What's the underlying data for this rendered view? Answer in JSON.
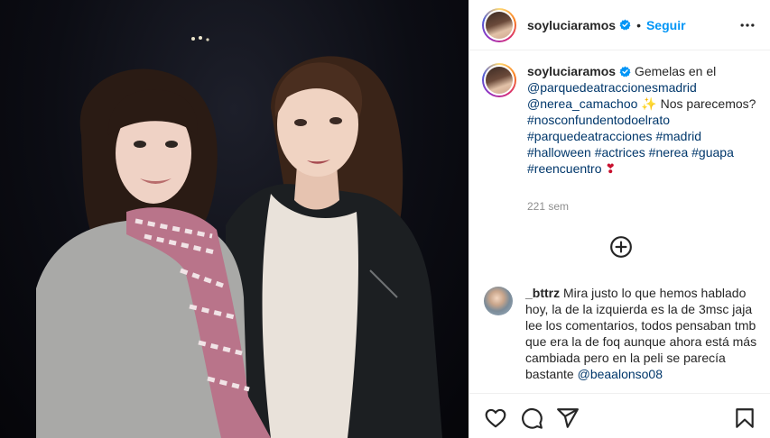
{
  "post": {
    "author": "soyluciaramos",
    "separator": "•",
    "follow_label": "Seguir",
    "more_icon": "more-horizontal-icon",
    "verified_color": "#0095f6"
  },
  "caption": {
    "username": "soyluciaramos",
    "intro": "Gemelas en el",
    "mention_1": "@parquedeatraccionesmadrid",
    "mention_2": "@nerea_camachoo",
    "sparkle_emoji": "✨",
    "question": "Nos parecemos?",
    "hashtags": [
      "#nosconfundentodoelrato",
      "#parquedeatracciones",
      "#madrid",
      "#halloween",
      "#actrices",
      "#nerea",
      "#guapa",
      "#reencuentro"
    ],
    "heart_emoji": "❣",
    "time_ago": "221 sem"
  },
  "load_more_icon": "plus-circle-icon",
  "comment": {
    "username": "_bttrz",
    "text": "Mira justo lo que hemos hablado hoy, la de la izquierda es la de 3msc jaja lee los comentarios, todos pensaban tmb que era la de foq aunque ahora está más cambiada pero en la peli se parecía bastante",
    "mention": "@beaalonso08"
  },
  "actions": {
    "like_icon": "heart-icon",
    "comment_icon": "comment-icon",
    "share_icon": "share-icon",
    "save_icon": "bookmark-icon"
  },
  "colors": {
    "link": "#00376b",
    "accent": "#0095f6",
    "muted": "#8e8e8e",
    "border": "#efefef"
  }
}
